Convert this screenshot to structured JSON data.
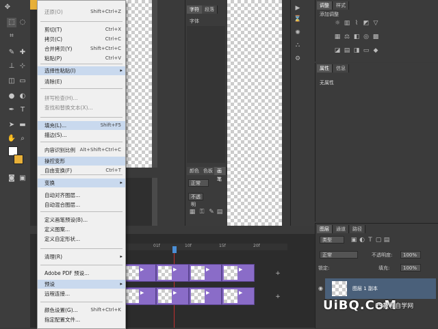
{
  "edit_menu": {
    "items": [
      {
        "label": "还原(O)",
        "shortcut": "Shift+Ctrl+Z",
        "state": "dim"
      },
      {
        "label": "剪切(T)",
        "shortcut": "Ctrl+X"
      },
      {
        "label": "拷贝(C)",
        "shortcut": "Ctrl+C"
      },
      {
        "label": "合并拷贝(Y)",
        "shortcut": "Shift+Ctrl+C"
      },
      {
        "label": "粘贴(P)",
        "shortcut": "Ctrl+V"
      },
      {
        "label": "选择性粘贴(I)",
        "submenu": true,
        "state": "hl"
      },
      {
        "label": "清除(E)"
      },
      {
        "label": "拼写检查(H)...",
        "state": "dim"
      },
      {
        "label": "查找和替换文本(X)...",
        "state": "dim"
      },
      {
        "label": "填充(L)...",
        "shortcut": "Shift+F5",
        "state": "hl"
      },
      {
        "label": "描边(S)..."
      },
      {
        "label": "内容识别比例",
        "shortcut": "Alt+Shift+Ctrl+C"
      },
      {
        "label": "操控变形",
        "state": "hl"
      },
      {
        "label": "自由变换(F)",
        "shortcut": "Ctrl+T"
      },
      {
        "label": "变换",
        "submenu": true,
        "state": "hl"
      },
      {
        "label": "自动对齐图层..."
      },
      {
        "label": "自动混合图层..."
      },
      {
        "label": "定义画笔预设(B)..."
      },
      {
        "label": "定义图案..."
      },
      {
        "label": "定义自定形状..."
      },
      {
        "label": "清理(R)",
        "submenu": true
      },
      {
        "label": "Adobe PDF 预设..."
      },
      {
        "label": "预设",
        "submenu": true,
        "state": "hl"
      },
      {
        "label": "远程连接..."
      },
      {
        "label": "颜色设置(G)...",
        "shortcut": "Shift+Ctrl+K"
      },
      {
        "label": "指定配置文件..."
      }
    ]
  },
  "right_panels": {
    "adjustments_tab": "调整",
    "styles_tab": "样式",
    "add_adjustment": "添加调整",
    "properties_tab": "属性",
    "info_tab": "信息",
    "properties_text": "无属性"
  },
  "middle_panel": {
    "top_tabs": [
      "字符",
      "段落"
    ],
    "top_label": "字体",
    "bottom_tabs": [
      "颜色",
      "色板",
      "画笔"
    ],
    "dropdown1": "正常",
    "dropdown2": "不透明"
  },
  "layers_panel": {
    "tabs": [
      "图层",
      "通道",
      "路径"
    ],
    "kind_filter": "类型",
    "blend_mode": "正常",
    "opacity_label": "不透明度:",
    "opacity_value": "100%",
    "fill_label": "填充:",
    "fill_value": "100%",
    "layer_name": "图层 1 副本"
  },
  "timeline": {
    "ticks": [
      "01f",
      "10f",
      "15f",
      "20f"
    ],
    "frame_label": "▶"
  },
  "watermark": {
    "text_logo": "UiBQ.CoM",
    "text_cn": "PS教程自学网"
  },
  "colors": {
    "accent_yellow": "#e8b038",
    "frame_purple": "#8a6cc8",
    "highlight": "#c9d9ee"
  }
}
